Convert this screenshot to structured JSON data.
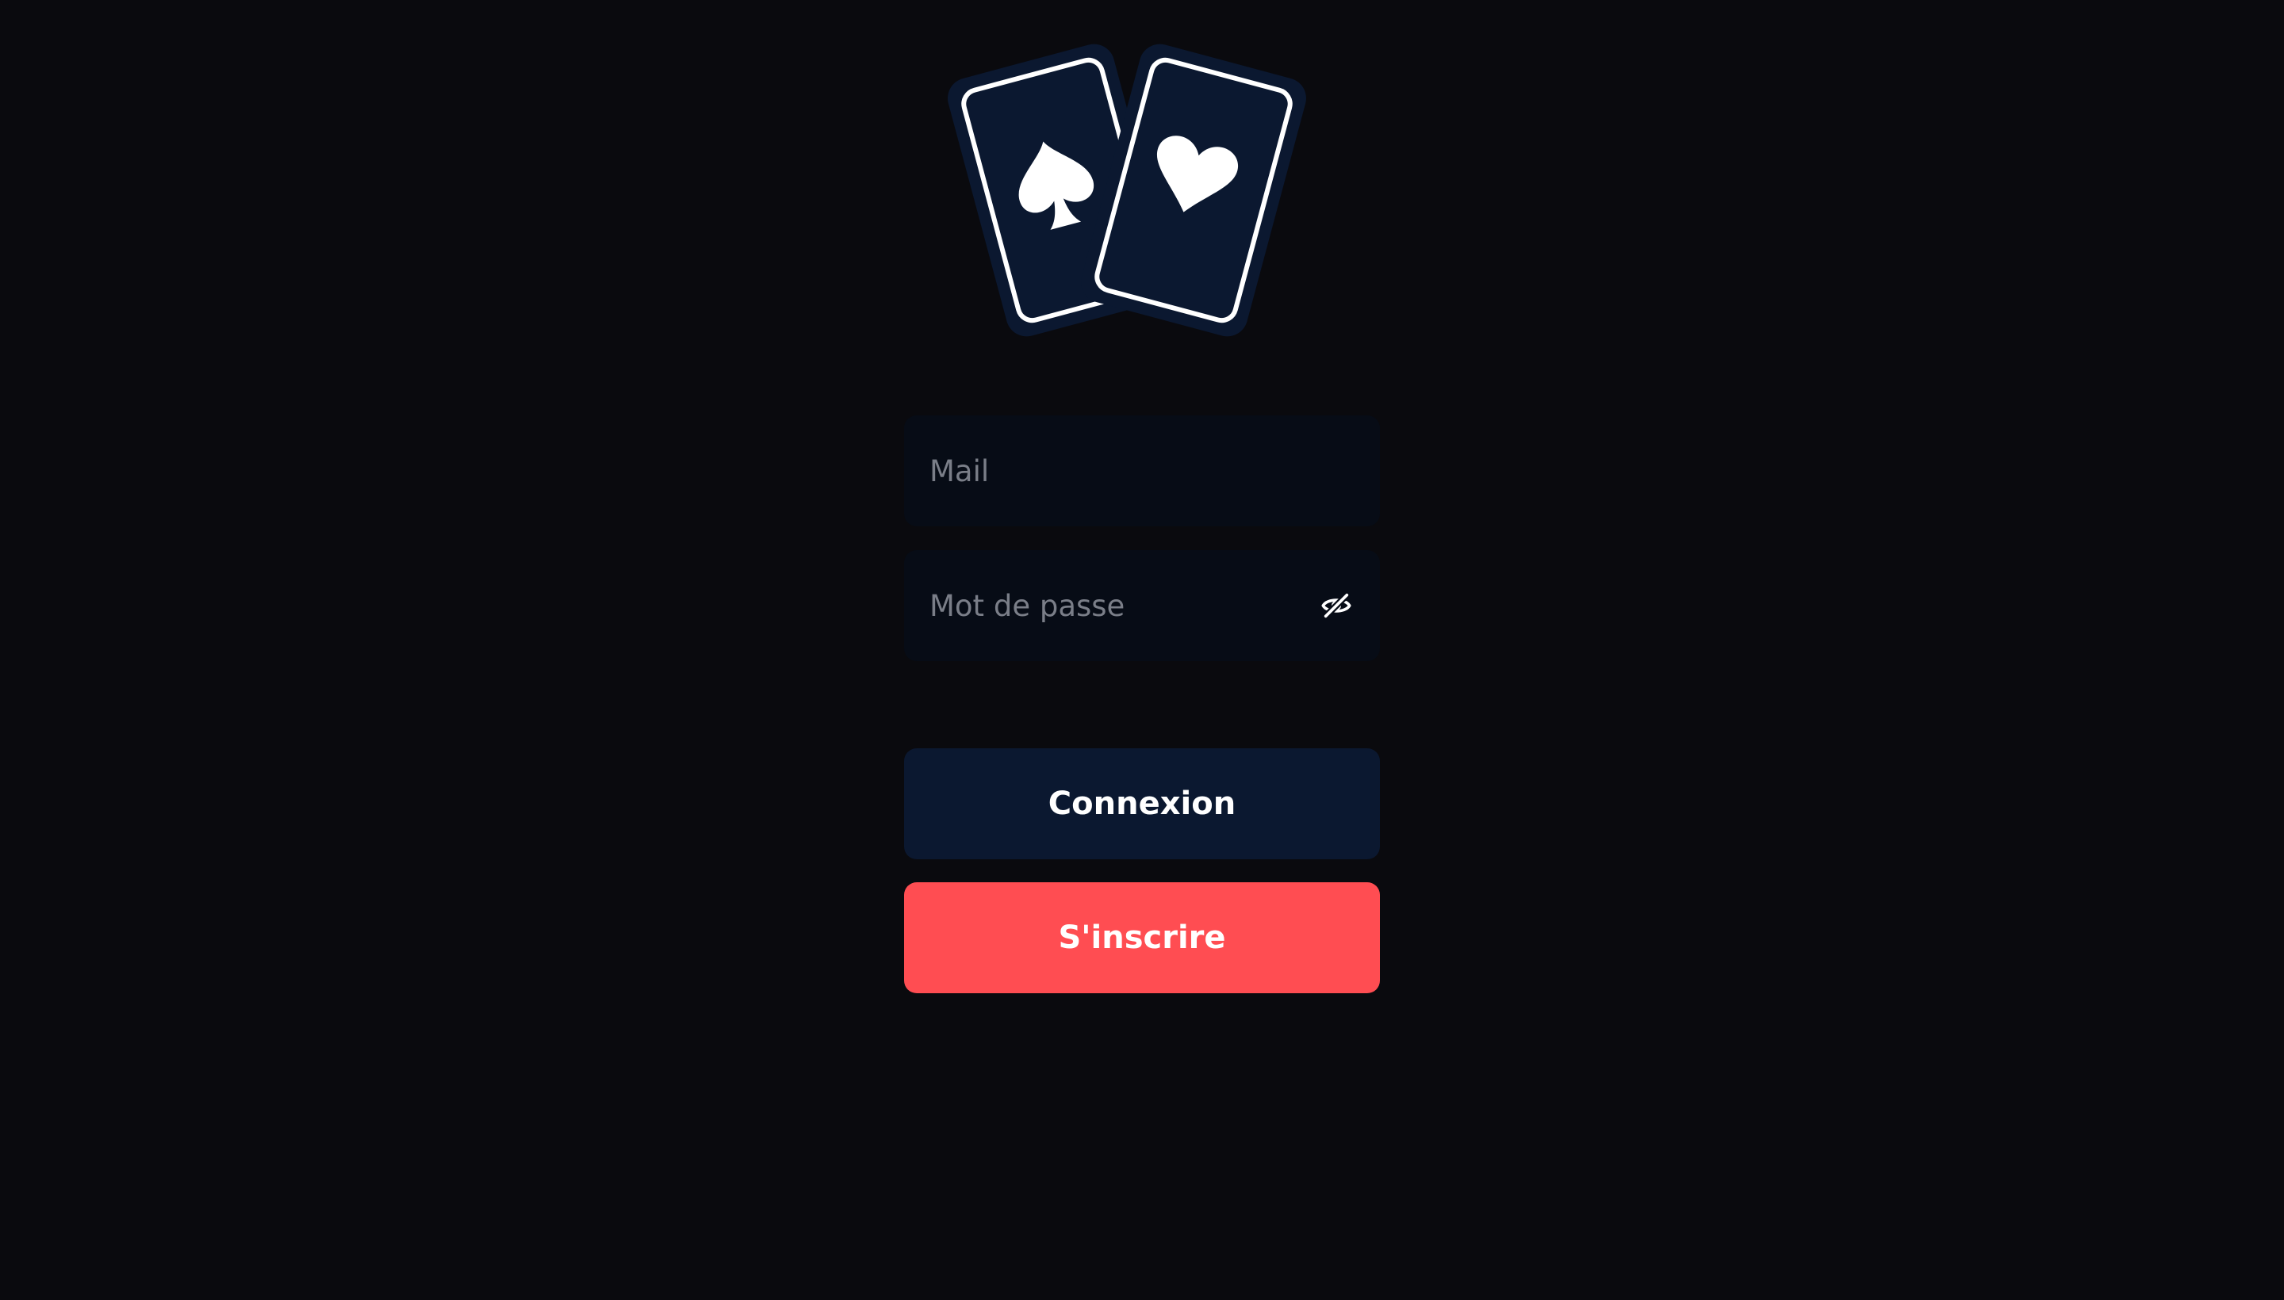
{
  "logo": {
    "icon": "playing-cards-icon",
    "card_fill": "#0b1830",
    "outline_color": "#ffffff",
    "suits": [
      "spade",
      "heart"
    ]
  },
  "form": {
    "mail_placeholder": "Mail",
    "password_placeholder": "Mot de passe",
    "password_toggle_icon": "eye-slash-icon"
  },
  "buttons": {
    "login_label": "Connexion",
    "signup_label": "S'inscrire"
  },
  "colors": {
    "background": "#0a0a0e",
    "field_bg": "#070c16",
    "login_bg": "#0b1830",
    "signup_bg": "#ff4d52",
    "placeholder": "#7a7e88"
  }
}
